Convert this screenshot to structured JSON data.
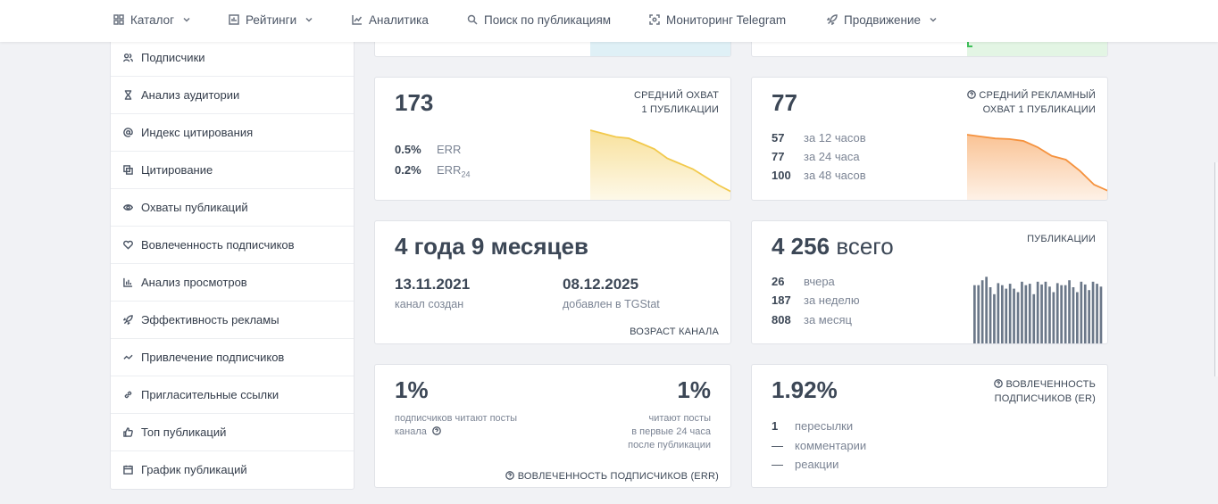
{
  "nav": {
    "catalog": "Каталог",
    "ratings": "Рейтинги",
    "analytics": "Аналитика",
    "search": "Поиск по публикациям",
    "monitoring": "Мониторинг Telegram",
    "promotion": "Продвижение"
  },
  "sidebar": {
    "items": [
      {
        "label": "Подписчики",
        "icon": "users-icon"
      },
      {
        "label": "Анализ аудитории",
        "icon": "hourglass-icon"
      },
      {
        "label": "Индекс цитирования",
        "icon": "at-icon"
      },
      {
        "label": "Цитирование",
        "icon": "copy-icon"
      },
      {
        "label": "Охваты публикаций",
        "icon": "eye-icon"
      },
      {
        "label": "Вовлеченность подписчиков",
        "icon": "heart-icon"
      },
      {
        "label": "Анализ просмотров",
        "icon": "bar-chart-icon"
      },
      {
        "label": "Эффективность рекламы",
        "icon": "rocket-icon"
      },
      {
        "label": "Привлечение подписчиков",
        "icon": "trend-icon"
      },
      {
        "label": "Пригласительные ссылки",
        "icon": "link-icon"
      },
      {
        "label": "Топ публикаций",
        "icon": "thumbs-up-icon"
      },
      {
        "label": "График публикаций",
        "icon": "calendar-icon"
      }
    ]
  },
  "reach": {
    "value": "173",
    "label_line1": "СРЕДНИЙ ОХВАТ",
    "label_line2": "1 ПУБЛИКАЦИИ",
    "err_value": "0.5%",
    "err_label": "ERR",
    "err24_value": "0.2%",
    "err24_label": "ERR",
    "err24_sub": "24",
    "sparkline": [
      1.0,
      0.95,
      0.9,
      0.88,
      0.8,
      0.72,
      0.58,
      0.5,
      0.42,
      0.3,
      0.18,
      0.08
    ],
    "color": "#f2c94c"
  },
  "ad_reach": {
    "value": "77",
    "label_line1": "СРЕДНИЙ РЕКЛАМНЫЙ",
    "label_line2": "ОХВАТ 1 ПУБЛИКАЦИИ",
    "rows": [
      {
        "value": "57",
        "label": "за 12 часов"
      },
      {
        "value": "77",
        "label": "за 24 часа"
      },
      {
        "value": "100",
        "label": "за 48 часов"
      }
    ],
    "sparkline": [
      1.0,
      0.97,
      0.94,
      0.93,
      0.9,
      0.8,
      0.66,
      0.6,
      0.42,
      0.2,
      0.1
    ],
    "color": "#f5923e"
  },
  "age": {
    "value": "4 года 9 месяцев",
    "created_date": "13.11.2021",
    "created_label": "канал создан",
    "added_date": "08.12.2025",
    "added_label": "добавлен в TGStat",
    "label": "ВОЗРАСТ КАНАЛА"
  },
  "posts": {
    "value": "4 256",
    "value_suffix": "всего",
    "label": "ПУБЛИКАЦИИ",
    "rows": [
      {
        "value": "26",
        "label": "вчера"
      },
      {
        "value": "187",
        "label": "за неделю"
      },
      {
        "value": "808",
        "label": "за месяц"
      }
    ],
    "bars": [
      0.85,
      0.85,
      0.92,
      0.97,
      0.82,
      0.72,
      0.88,
      0.85,
      0.8,
      0.87,
      0.8,
      0.75,
      0.9,
      0.85,
      0.87,
      0.72,
      0.9,
      0.86,
      0.9,
      0.83,
      0.75,
      0.88,
      0.85,
      0.85,
      0.92,
      0.82,
      0.75,
      0.9,
      0.86,
      0.78,
      0.9,
      0.87,
      0.83
    ],
    "bar_color": "#6b7889"
  },
  "err": {
    "left_value": "1%",
    "left_line1": "подписчиков читают посты",
    "left_line2": "канала",
    "right_value": "1%",
    "right_line1": "читают посты",
    "right_line2": "в первые 24 часа",
    "right_line3": "после публикации",
    "label": "ВОВЛЕЧЕННОСТЬ ПОДПИСЧИКОВ (ERR)"
  },
  "er": {
    "value": "1.92%",
    "label_line1": "ВОВЛЕЧЕННОСТЬ",
    "label_line2": "ПОДПИСЧИКОВ (ER)",
    "rows": [
      {
        "value": "1",
        "label": "пересылки"
      },
      {
        "value": "—",
        "label": "комментарии"
      },
      {
        "value": "—",
        "label": "реакции"
      }
    ]
  }
}
